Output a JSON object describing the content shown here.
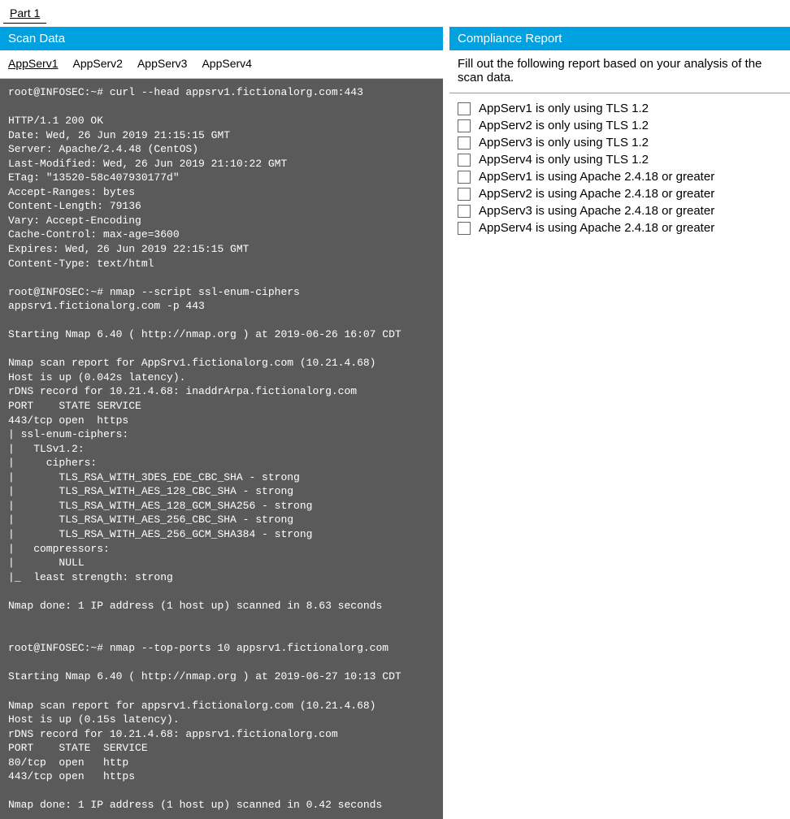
{
  "part_label": "Part 1",
  "left": {
    "header": "Scan Data",
    "tabs": [
      "AppServ1",
      "AppServ2",
      "AppServ3",
      "AppServ4"
    ],
    "active_tab": 0,
    "terminal": "root@INFOSEC:~# curl --head appsrv1.fictionalorg.com:443\n\nHTTP/1.1 200 OK\nDate: Wed, 26 Jun 2019 21:15:15 GMT\nServer: Apache/2.4.48 (CentOS)\nLast-Modified: Wed, 26 Jun 2019 21:10:22 GMT\nETag: \"13520-58c407930177d\"\nAccept-Ranges: bytes\nContent-Length: 79136\nVary: Accept-Encoding\nCache-Control: max-age=3600\nExpires: Wed, 26 Jun 2019 22:15:15 GMT\nContent-Type: text/html\n\nroot@INFOSEC:~# nmap --script ssl-enum-ciphers\nappsrv1.fictionalorg.com -p 443\n\nStarting Nmap 6.40 ( http://nmap.org ) at 2019-06-26 16:07 CDT\n\nNmap scan report for AppSrv1.fictionalorg.com (10.21.4.68)\nHost is up (0.042s latency).\nrDNS record for 10.21.4.68: inaddrArpa.fictionalorg.com\nPORT    STATE SERVICE\n443/tcp open  https\n| ssl-enum-ciphers:\n|   TLSv1.2:\n|     ciphers:\n|       TLS_RSA_WITH_3DES_EDE_CBC_SHA - strong\n|       TLS_RSA_WITH_AES_128_CBC_SHA - strong\n|       TLS_RSA_WITH_AES_128_GCM_SHA256 - strong\n|       TLS_RSA_WITH_AES_256_CBC_SHA - strong\n|       TLS_RSA_WITH_AES_256_GCM_SHA384 - strong\n|   compressors:\n|       NULL\n|_  least strength: strong\n\nNmap done: 1 IP address (1 host up) scanned in 8.63 seconds\n\n\nroot@INFOSEC:~# nmap --top-ports 10 appsrv1.fictionalorg.com\n\nStarting Nmap 6.40 ( http://nmap.org ) at 2019-06-27 10:13 CDT\n\nNmap scan report for appsrv1.fictionalorg.com (10.21.4.68)\nHost is up (0.15s latency).\nrDNS record for 10.21.4.68: appsrv1.fictionalorg.com\nPORT    STATE  SERVICE\n80/tcp  open   http\n443/tcp open   https\n\nNmap done: 1 IP address (1 host up) scanned in 0.42 seconds"
  },
  "right": {
    "header": "Compliance Report",
    "instruction": "Fill out the following report based on your analysis of the scan data.",
    "items": [
      "AppServ1 is only using TLS 1.2",
      "AppServ2 is only using TLS 1.2",
      "AppServ3 is only using TLS 1.2",
      "AppServ4 is only using TLS 1.2",
      "AppServ1 is using Apache 2.4.18 or greater",
      "AppServ2 is using Apache 2.4.18 or greater",
      "AppServ3 is using Apache 2.4.18 or greater",
      "AppServ4 is using Apache 2.4.18 or greater"
    ]
  }
}
